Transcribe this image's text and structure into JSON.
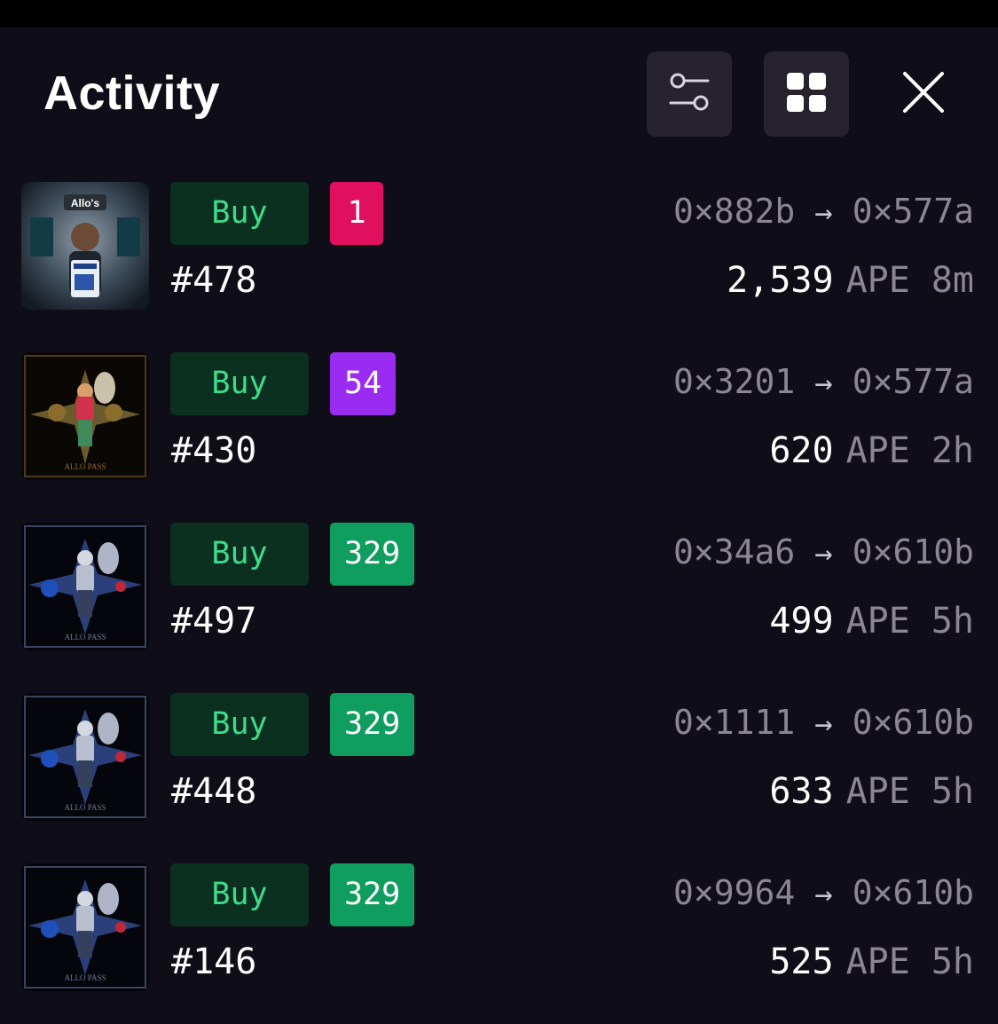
{
  "header": {
    "title": "Activity",
    "filter_icon": "sliders-icon",
    "grid_icon": "grid-icon",
    "close_icon": "close-icon"
  },
  "colors": {
    "background": "#0f0d17",
    "button_bg": "#26232f",
    "buy_bg": "#0b3020",
    "buy_text": "#3fdc8a",
    "muted_text": "#8a8696"
  },
  "activity": [
    {
      "type": "Buy",
      "qty": "1",
      "qty_color": "#e0105f",
      "token": "#478",
      "from": "0×882b",
      "to": "0×577a",
      "price": "2,539",
      "unit": "APE",
      "time": "8m",
      "thumb": "allo-avatar"
    },
    {
      "type": "Buy",
      "qty": "54",
      "qty_color": "#9a2cf2",
      "token": "#430",
      "from": "0×3201",
      "to": "0×577a",
      "price": "620",
      "unit": "APE",
      "time": "2h",
      "thumb": "allo-pass-gold"
    },
    {
      "type": "Buy",
      "qty": "329",
      "qty_color": "#0f9e5f",
      "token": "#497",
      "from": "0×34a6",
      "to": "0×610b",
      "price": "499",
      "unit": "APE",
      "time": "5h",
      "thumb": "allo-pass-blue"
    },
    {
      "type": "Buy",
      "qty": "329",
      "qty_color": "#0f9e5f",
      "token": "#448",
      "from": "0×1111",
      "to": "0×610b",
      "price": "633",
      "unit": "APE",
      "time": "5h",
      "thumb": "allo-pass-blue"
    },
    {
      "type": "Buy",
      "qty": "329",
      "qty_color": "#0f9e5f",
      "token": "#146",
      "from": "0×9964",
      "to": "0×610b",
      "price": "525",
      "unit": "APE",
      "time": "5h",
      "thumb": "allo-pass-blue"
    }
  ]
}
